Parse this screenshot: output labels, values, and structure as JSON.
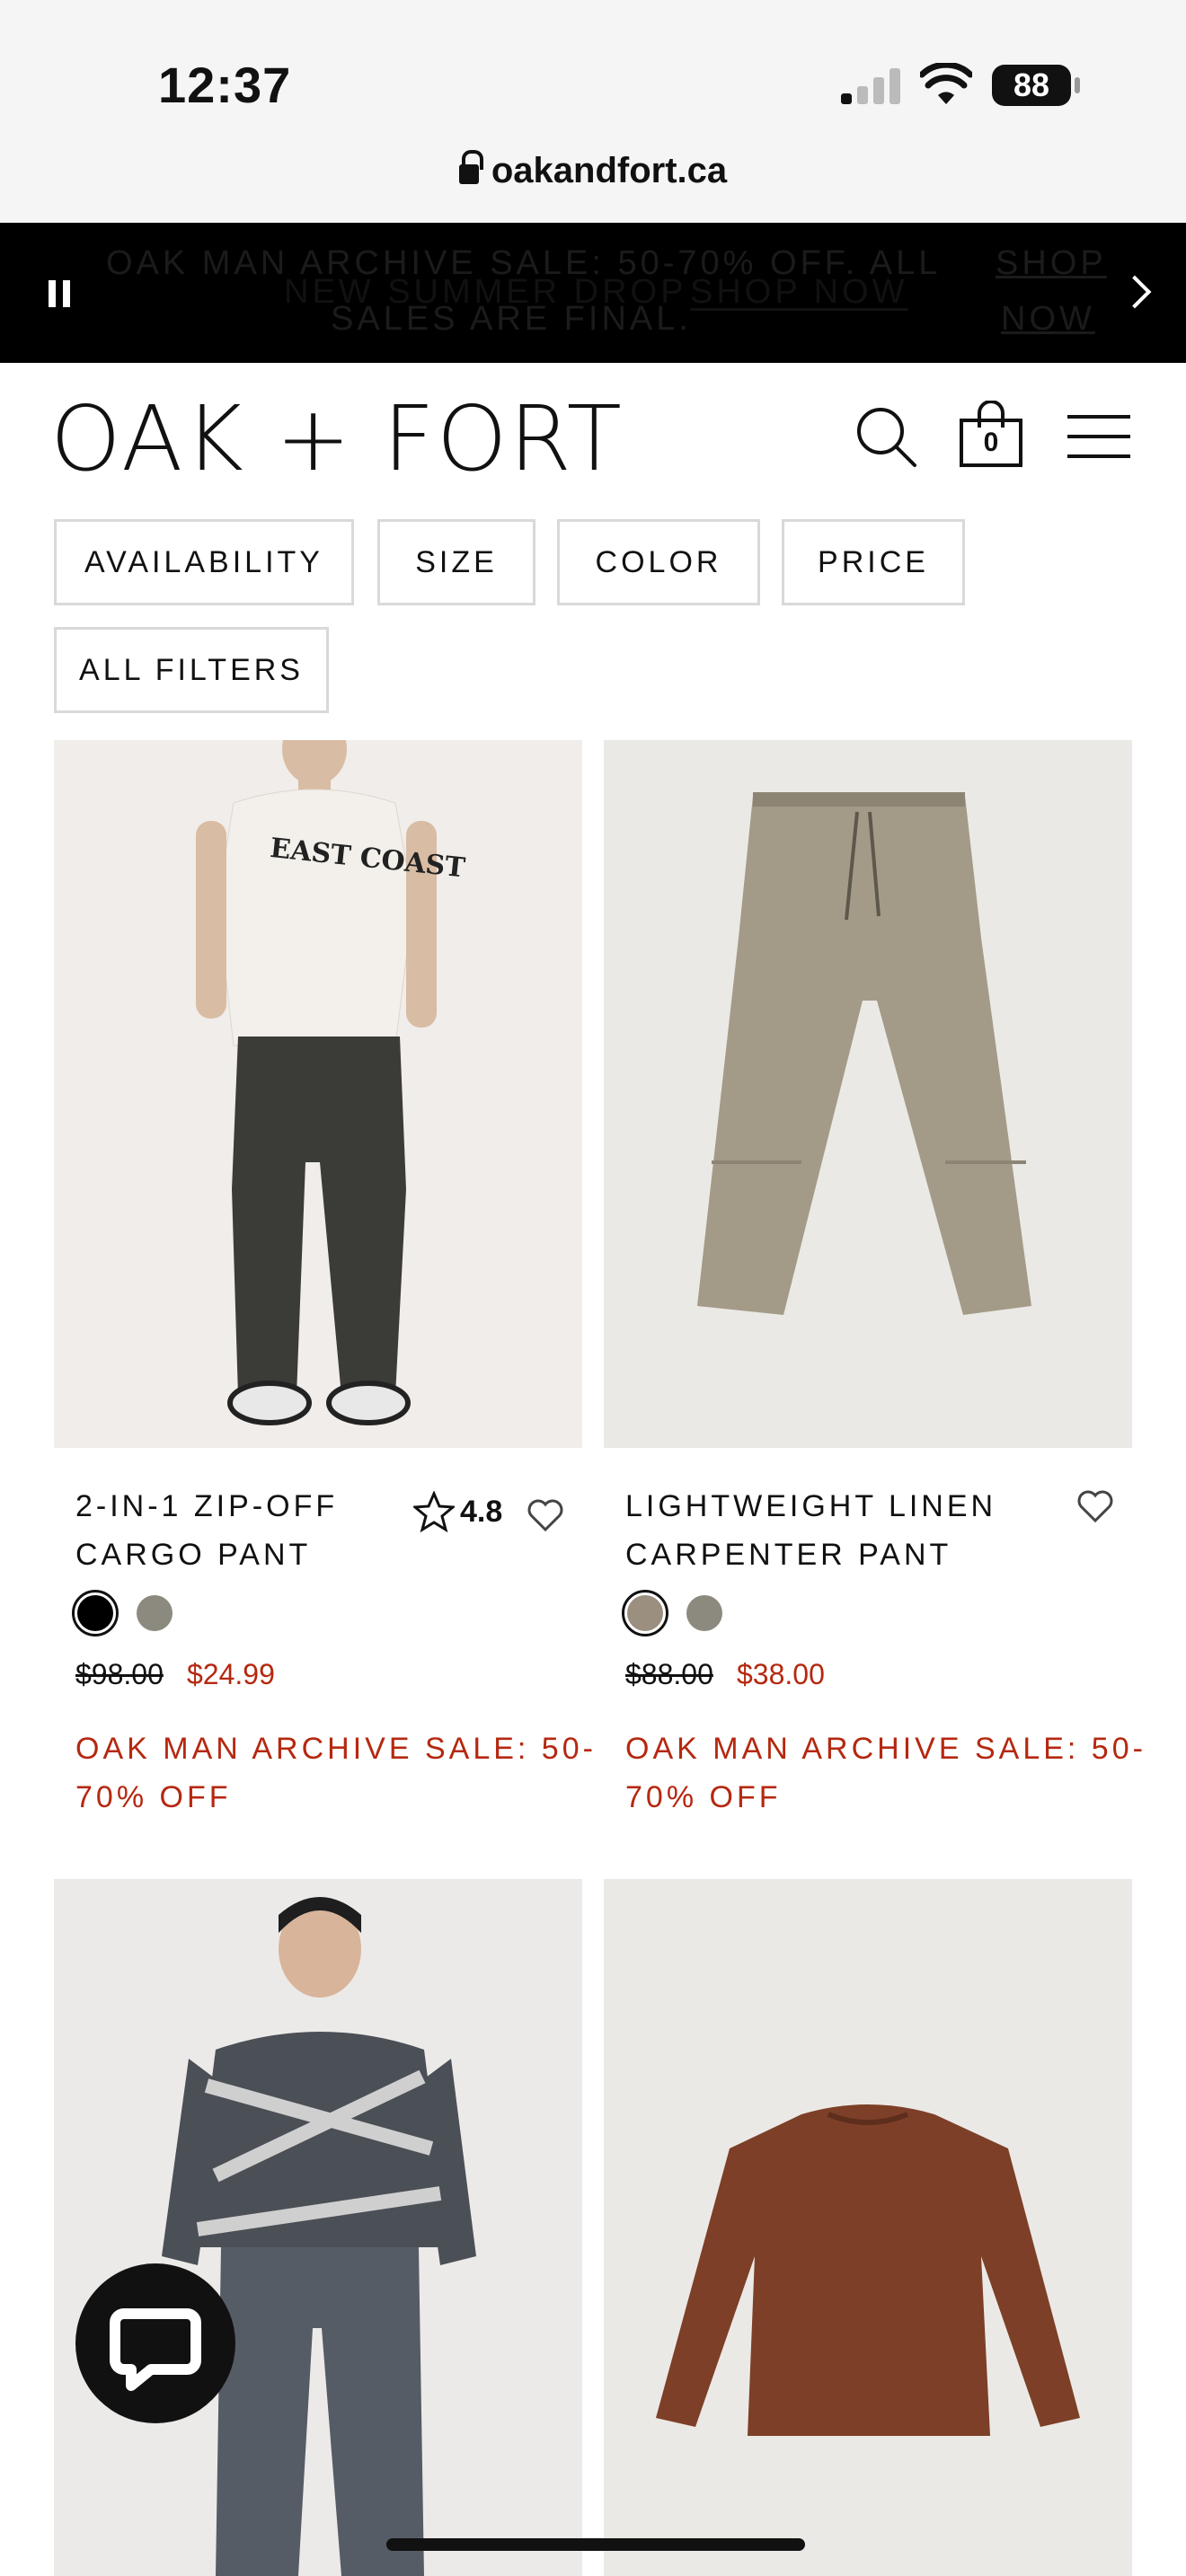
{
  "status_bar": {
    "time": "12:37",
    "battery": "88"
  },
  "browser": {
    "url": "oakandfort.ca"
  },
  "announcement": {
    "ghost_line1": "OAK MAN ARCHIVE SALE: 50-70% OFF. ALL",
    "ghost_line2": "SALES ARE FINAL.",
    "ghost_link1": "SHOP",
    "ghost_link2": "NOW",
    "text": "NEW SUMMER DROP",
    "link": "SHOP NOW"
  },
  "header": {
    "logo": "OAK + FORT",
    "cart_count": "0"
  },
  "filters": [
    "AVAILABILITY",
    "SIZE",
    "COLOR",
    "PRICE",
    "ALL FILTERS"
  ],
  "products": [
    {
      "name_line1": "2-IN-1 ZIP-OFF",
      "name_line2": "CARGO PANT",
      "rating": "4.8",
      "old_price": "$98.00",
      "price": "$24.99",
      "promo_line1": "OAK MAN ARCHIVE SALE: 50-",
      "promo_line2": "70% OFF",
      "swatches": [
        "#000000",
        "#8c8a7e"
      ]
    },
    {
      "name_line1": "LIGHTWEIGHT LINEN",
      "name_line2": "CARPENTER PANT",
      "old_price": "$88.00",
      "price": "$38.00",
      "promo_line1": "OAK MAN ARCHIVE SALE: 50-",
      "promo_line2": "70% OFF",
      "swatches": [
        "#9b8f7f",
        "#8c8a7e"
      ]
    }
  ],
  "colors": {
    "sale_red": "#b52810",
    "announcement_bg": "#000000"
  }
}
